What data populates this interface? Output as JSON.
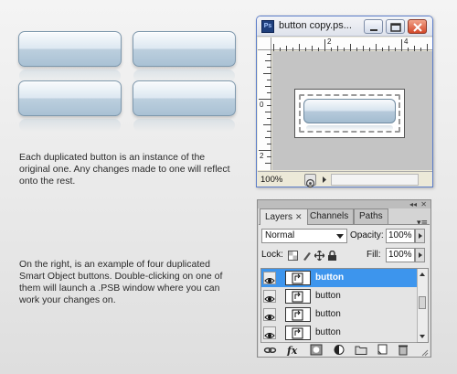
{
  "description": {
    "paragraph1": [
      "Each duplicated button is an instance of the",
      "original one. Any changes made to one will reflect",
      "onto the rest."
    ],
    "paragraph2": [
      "On the right, is an example of four duplicated",
      "Smart Object buttons. Double-clicking on one of",
      "them will launch a .PSB window where you can",
      "work your changes on."
    ]
  },
  "document_window": {
    "app_icon": "Ps",
    "title": "button copy.ps...",
    "ruler_h_labels": [
      "2",
      "4"
    ],
    "ruler_v_labels": [
      "0",
      "2"
    ],
    "zoom": "100%"
  },
  "layers_panel": {
    "tabs": [
      {
        "label": "Layers",
        "active": true
      },
      {
        "label": "Channels",
        "active": false
      },
      {
        "label": "Paths",
        "active": false
      }
    ],
    "blend_mode": "Normal",
    "opacity_label": "Opacity:",
    "opacity_value": "100%",
    "lock_label": "Lock:",
    "fill_label": "Fill:",
    "fill_value": "100%",
    "layers": [
      {
        "name": "button",
        "selected": true
      },
      {
        "name": "button",
        "selected": false
      },
      {
        "name": "button",
        "selected": false
      },
      {
        "name": "button",
        "selected": false
      }
    ],
    "bottom_icons": [
      "link-icon",
      "fx-icon",
      "mask-icon",
      "adjustment-icon",
      "group-icon",
      "new-layer-icon",
      "trash-icon"
    ]
  },
  "colors": {
    "selection_blue": "#3d95ed",
    "button_border": "#7e98ad"
  }
}
